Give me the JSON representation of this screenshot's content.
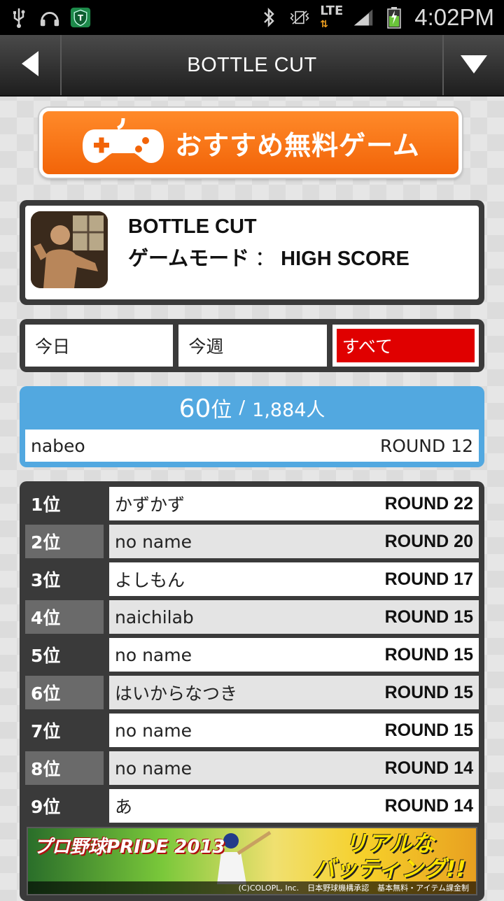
{
  "status_bar": {
    "time": "4:02PM",
    "network": "LTE",
    "icons": [
      "usb-icon",
      "headphones-icon",
      "shield-app-icon",
      "bluetooth-icon",
      "vibrate-icon",
      "signal-icon",
      "battery-icon"
    ]
  },
  "title_bar": {
    "title": "BOTTLE CUT",
    "back_icon": "back-arrow-icon",
    "menu_icon": "dropdown-triangle-icon"
  },
  "banner": {
    "label": "おすすめ無料ゲーム",
    "icon": "gamepad-icon",
    "color": "#f26408"
  },
  "game": {
    "title": "BOTTLE CUT",
    "mode_label": "ゲームモード",
    "mode_sep": "：",
    "mode_value": "HIGH SCORE"
  },
  "tabs": [
    {
      "label": "今日",
      "active": false
    },
    {
      "label": "今週",
      "active": false
    },
    {
      "label": "すべて",
      "active": true
    }
  ],
  "my_rank": {
    "rank": "60",
    "rank_suffix": "位",
    "separator": "/",
    "total": "1,884人",
    "name": "nabeo",
    "score": "ROUND 12"
  },
  "ranking": [
    {
      "pos": "1位",
      "name": "かずかず",
      "score": "ROUND 22"
    },
    {
      "pos": "2位",
      "name": "no name",
      "score": "ROUND 20"
    },
    {
      "pos": "3位",
      "name": "よしもん",
      "score": "ROUND 17"
    },
    {
      "pos": "4位",
      "name": "naichilab",
      "score": "ROUND 15"
    },
    {
      "pos": "5位",
      "name": "no name",
      "score": "ROUND 15"
    },
    {
      "pos": "6位",
      "name": "はいからなつき",
      "score": "ROUND 15"
    },
    {
      "pos": "7位",
      "name": "no name",
      "score": "ROUND 15"
    },
    {
      "pos": "8位",
      "name": "no name",
      "score": "ROUND 14"
    },
    {
      "pos": "9位",
      "name": "あ",
      "score": "ROUND 14"
    }
  ],
  "ad": {
    "left_text": "プロ野球PRIDE 2013",
    "right_line1": "リアルな",
    "right_line2": "バッティング!!",
    "footer_copyright": "(C)COLOPL, Inc.",
    "footer_license": "日本野球機構承認",
    "footer_note": "基本無料・アイテム課金制"
  },
  "colors": {
    "accent_red": "#e00000",
    "my_rank_blue": "#52a8e0",
    "panel_dark": "#3a3a3a"
  }
}
